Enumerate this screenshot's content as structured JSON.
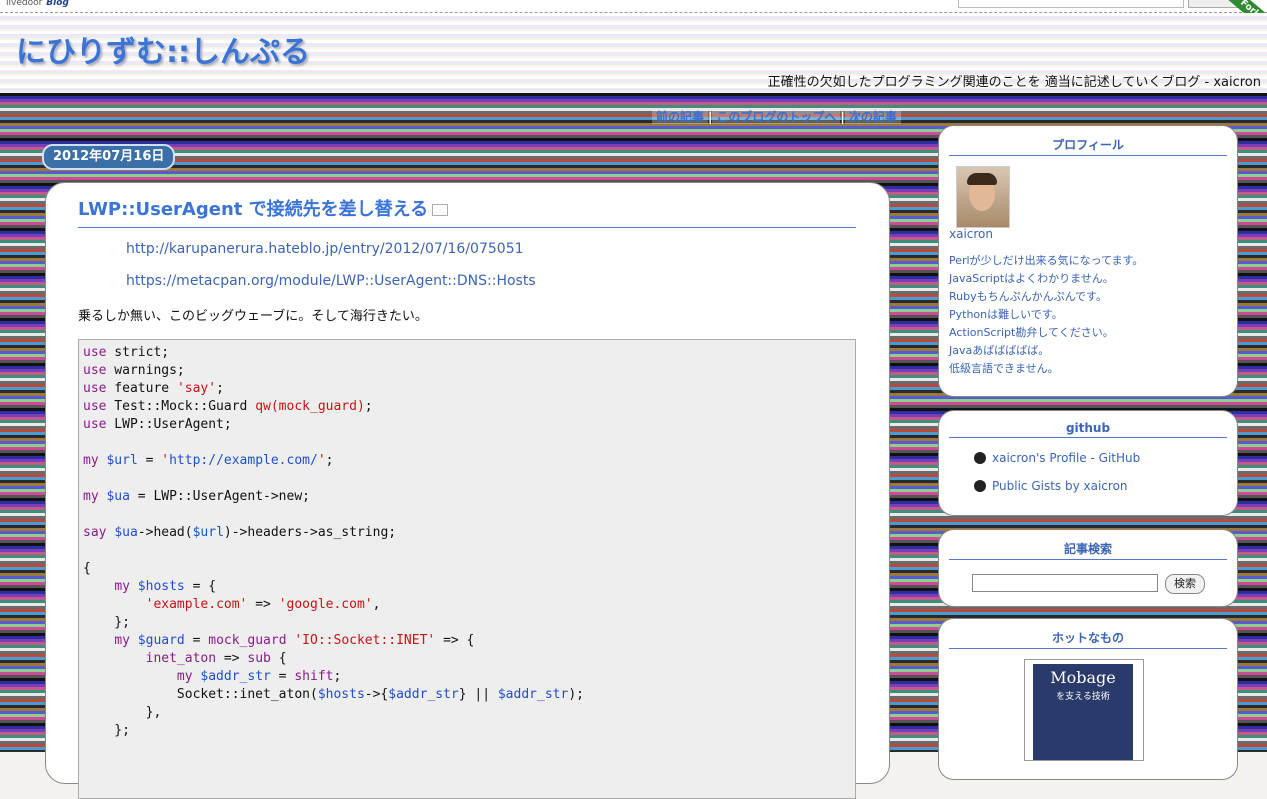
{
  "topbar": {
    "brand_prefix": "livedoor",
    "brand_name": "Blog"
  },
  "ribbon": "Fork",
  "header": {
    "title": "にひりずむ::しんぷる",
    "description": "正確性の欠如したプログラミング関連のことを 適当に記述していくブログ - xaicron"
  },
  "nav": {
    "prev": "前の記事",
    "top": "このブログのトップへ",
    "next": "次の記事",
    "sep": "|"
  },
  "entry": {
    "date": "2012年07月16日",
    "title": "LWP::UserAgent で接続先を差し替える",
    "links": [
      "http://karupanerura.hateblo.jp/entry/2012/07/16/075051",
      "https://metacpan.org/module/LWP::UserAgent::DNS::Hosts"
    ],
    "paragraph": "乗るしか無い、このビッグウェーブに。そして海行きたい。",
    "code": [
      [
        [
          "kw",
          "use"
        ],
        [
          "pl",
          " strict;"
        ]
      ],
      [
        [
          "kw",
          "use"
        ],
        [
          "pl",
          " warnings;"
        ]
      ],
      [
        [
          "kw",
          "use"
        ],
        [
          "pl",
          " feature "
        ],
        [
          "str",
          "'say'"
        ],
        [
          "pl",
          ";"
        ]
      ],
      [
        [
          "kw",
          "use"
        ],
        [
          "pl",
          " Test::Mock::Guard "
        ],
        [
          "str",
          "qw(mock_guard)"
        ],
        [
          "pl",
          ";"
        ]
      ],
      [
        [
          "kw",
          "use"
        ],
        [
          "pl",
          " LWP::UserAgent;"
        ]
      ],
      [],
      [
        [
          "kw",
          "my"
        ],
        [
          "pl",
          " "
        ],
        [
          "var",
          "$url"
        ],
        [
          "pl",
          " = "
        ],
        [
          "str",
          "'"
        ],
        [
          "var",
          "http://example.com/"
        ],
        [
          "str",
          "'"
        ],
        [
          "pl",
          ";"
        ]
      ],
      [],
      [
        [
          "kw",
          "my"
        ],
        [
          "pl",
          " "
        ],
        [
          "var",
          "$ua"
        ],
        [
          "pl",
          " = LWP::UserAgent->new;"
        ]
      ],
      [],
      [
        [
          "kw",
          "say"
        ],
        [
          "pl",
          " "
        ],
        [
          "var",
          "$ua"
        ],
        [
          "pl",
          "->head("
        ],
        [
          "var",
          "$url"
        ],
        [
          "pl",
          ")->headers->as_string;"
        ]
      ],
      [],
      [
        [
          "pl",
          "{"
        ]
      ],
      [
        [
          "pl",
          "    "
        ],
        [
          "kw",
          "my"
        ],
        [
          "pl",
          " "
        ],
        [
          "var",
          "$hosts"
        ],
        [
          "pl",
          " = {"
        ]
      ],
      [
        [
          "pl",
          "        "
        ],
        [
          "str",
          "'example.com'"
        ],
        [
          "pl",
          " => "
        ],
        [
          "str",
          "'google.com'"
        ],
        [
          "pl",
          ","
        ]
      ],
      [
        [
          "pl",
          "    };"
        ]
      ],
      [
        [
          "pl",
          "    "
        ],
        [
          "kw",
          "my"
        ],
        [
          "pl",
          " "
        ],
        [
          "var",
          "$guard"
        ],
        [
          "pl",
          " = "
        ],
        [
          "kw",
          "mock_guard"
        ],
        [
          "pl",
          " "
        ],
        [
          "str",
          "'IO::Socket::INET'"
        ],
        [
          "pl",
          " => {"
        ]
      ],
      [
        [
          "pl",
          "        "
        ],
        [
          "kw",
          "inet_aton"
        ],
        [
          "pl",
          " => "
        ],
        [
          "kw",
          "sub"
        ],
        [
          "pl",
          " {"
        ]
      ],
      [
        [
          "pl",
          "            "
        ],
        [
          "kw",
          "my"
        ],
        [
          "pl",
          " "
        ],
        [
          "var",
          "$addr_str"
        ],
        [
          "pl",
          " = "
        ],
        [
          "kw",
          "shift"
        ],
        [
          "pl",
          ";"
        ]
      ],
      [
        [
          "pl",
          "            Socket::inet_aton("
        ],
        [
          "var",
          "$hosts"
        ],
        [
          "pl",
          "->{"
        ],
        [
          "var",
          "$addr_str"
        ],
        [
          "pl",
          "} || "
        ],
        [
          "var",
          "$addr_str"
        ],
        [
          "pl",
          ");"
        ]
      ],
      [
        [
          "pl",
          "        },"
        ]
      ],
      [
        [
          "pl",
          "    };"
        ]
      ]
    ]
  },
  "sidebar": {
    "profile": {
      "title": "プロフィール",
      "name": "xaicron",
      "lines": [
        "Perlが少しだけ出来る気になってます。",
        "JavaScriptはよくわかりません。",
        "Rubyもちんぷんかんぷんです。",
        "Pythonは難しいです。",
        "ActionScript勘弁してください。",
        "Javaあばばばばば。",
        "低級言語できません。"
      ]
    },
    "github": {
      "title": "github",
      "items": [
        "xaicron's Profile - GitHub",
        "Public Gists by xaicron"
      ]
    },
    "search": {
      "title": "記事検索",
      "button": "検索"
    },
    "hot": {
      "title": "ホットなもの",
      "book_title": "Mobage",
      "book_subtitle": "を支える技術"
    }
  }
}
